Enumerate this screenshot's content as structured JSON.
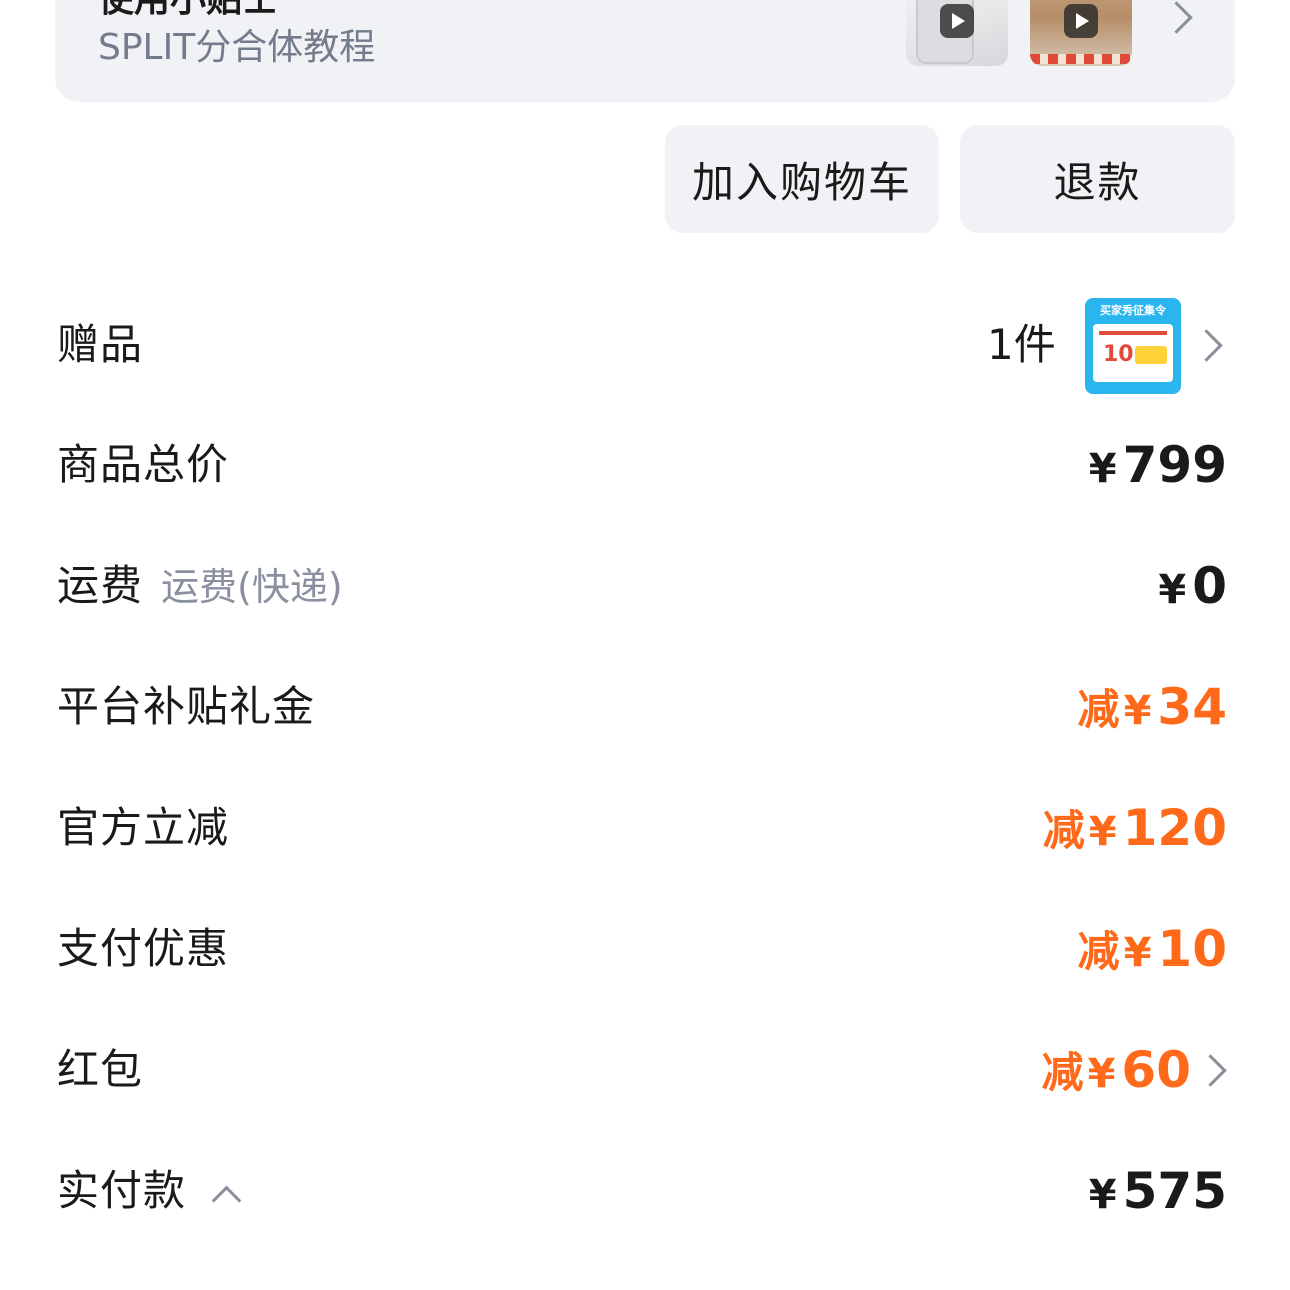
{
  "guide": {
    "title": "使用小贴士",
    "subtitle": "SPLIT分合体教程"
  },
  "actions": {
    "add_to_cart": "加入购物车",
    "refund": "退款"
  },
  "gift": {
    "label": "赠品",
    "count": "1件",
    "thumb_title": "买家秀征集令",
    "thumb_amount": "10"
  },
  "summary": {
    "subtotal": {
      "label": "商品总价",
      "currency": "¥",
      "amount": "799"
    },
    "shipping": {
      "label": "运费",
      "note": "运费(快递)",
      "currency": "¥",
      "amount": "0"
    },
    "platform_subsidy": {
      "label": "平台补贴礼金",
      "prefix": "减",
      "currency": "¥",
      "amount": "34"
    },
    "official_discount": {
      "label": "官方立减",
      "prefix": "减",
      "currency": "¥",
      "amount": "120"
    },
    "payment_discount": {
      "label": "支付优惠",
      "prefix": "减",
      "currency": "¥",
      "amount": "10"
    },
    "red_packet": {
      "label": "红包",
      "prefix": "减",
      "currency": "¥",
      "amount": "60"
    },
    "paid": {
      "label": "实付款",
      "currency": "¥",
      "amount": "575"
    }
  },
  "colors": {
    "discount": "#ff6a1a",
    "card_bg": "#f1f2f5",
    "muted": "#8a90a0"
  }
}
